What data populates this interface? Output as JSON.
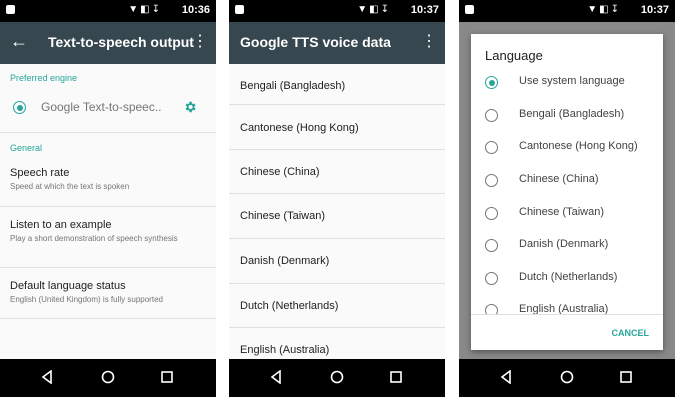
{
  "screen1": {
    "status_time": "10:36",
    "title": "Text-to-speech output",
    "section_engine": "Preferred engine",
    "engine_name": "Google Text-to-speec..",
    "section_general": "General",
    "items": [
      {
        "title": "Speech rate",
        "subtitle": "Speed at which the text is spoken"
      },
      {
        "title": "Listen to an example",
        "subtitle": "Play a short demonstration of speech synthesis"
      },
      {
        "title": "Default language status",
        "subtitle": "English (United Kingdom) is fully supported"
      }
    ]
  },
  "screen2": {
    "status_time": "10:37",
    "title": "Google TTS voice data",
    "languages": [
      "Bengali (Bangladesh)",
      "Cantonese (Hong Kong)",
      "Chinese (China)",
      "Chinese (Taiwan)",
      "Danish (Denmark)",
      "Dutch (Netherlands)",
      "English (Australia)"
    ]
  },
  "screen3": {
    "status_time": "10:37",
    "dialog_title": "Language",
    "selected_index": 0,
    "options": [
      "Use system language",
      "Bengali (Bangladesh)",
      "Cantonese (Hong Kong)",
      "Chinese (China)",
      "Chinese (Taiwan)",
      "Danish (Denmark)",
      "Dutch (Netherlands)",
      "English (Australia)"
    ],
    "cancel_label": "CANCEL"
  },
  "colors": {
    "toolbar": "#37474f",
    "accent": "#26a69a",
    "status_bar": "#000000"
  },
  "icons": [
    "back-arrow-icon",
    "overflow-menu-icon",
    "gear-icon",
    "radio-selected-icon",
    "nav-back-icon",
    "nav-home-icon",
    "nav-recent-icon"
  ]
}
